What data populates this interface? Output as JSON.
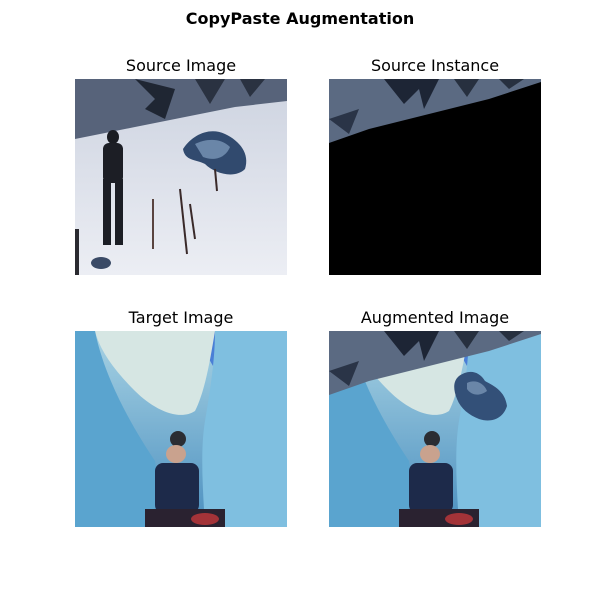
{
  "figure": {
    "title": "CopyPaste Augmentation"
  },
  "panels": [
    {
      "title": "Source Image"
    },
    {
      "title": "Source Instance"
    },
    {
      "title": "Target Image"
    },
    {
      "title": "Augmented Image"
    }
  ],
  "colors": {
    "snow": "#dfe3ee",
    "sky_strip": "#4d5a70",
    "ice_light": "#a9d6ea",
    "ice_deep": "#4f93c2",
    "mask_black": "#000000"
  }
}
